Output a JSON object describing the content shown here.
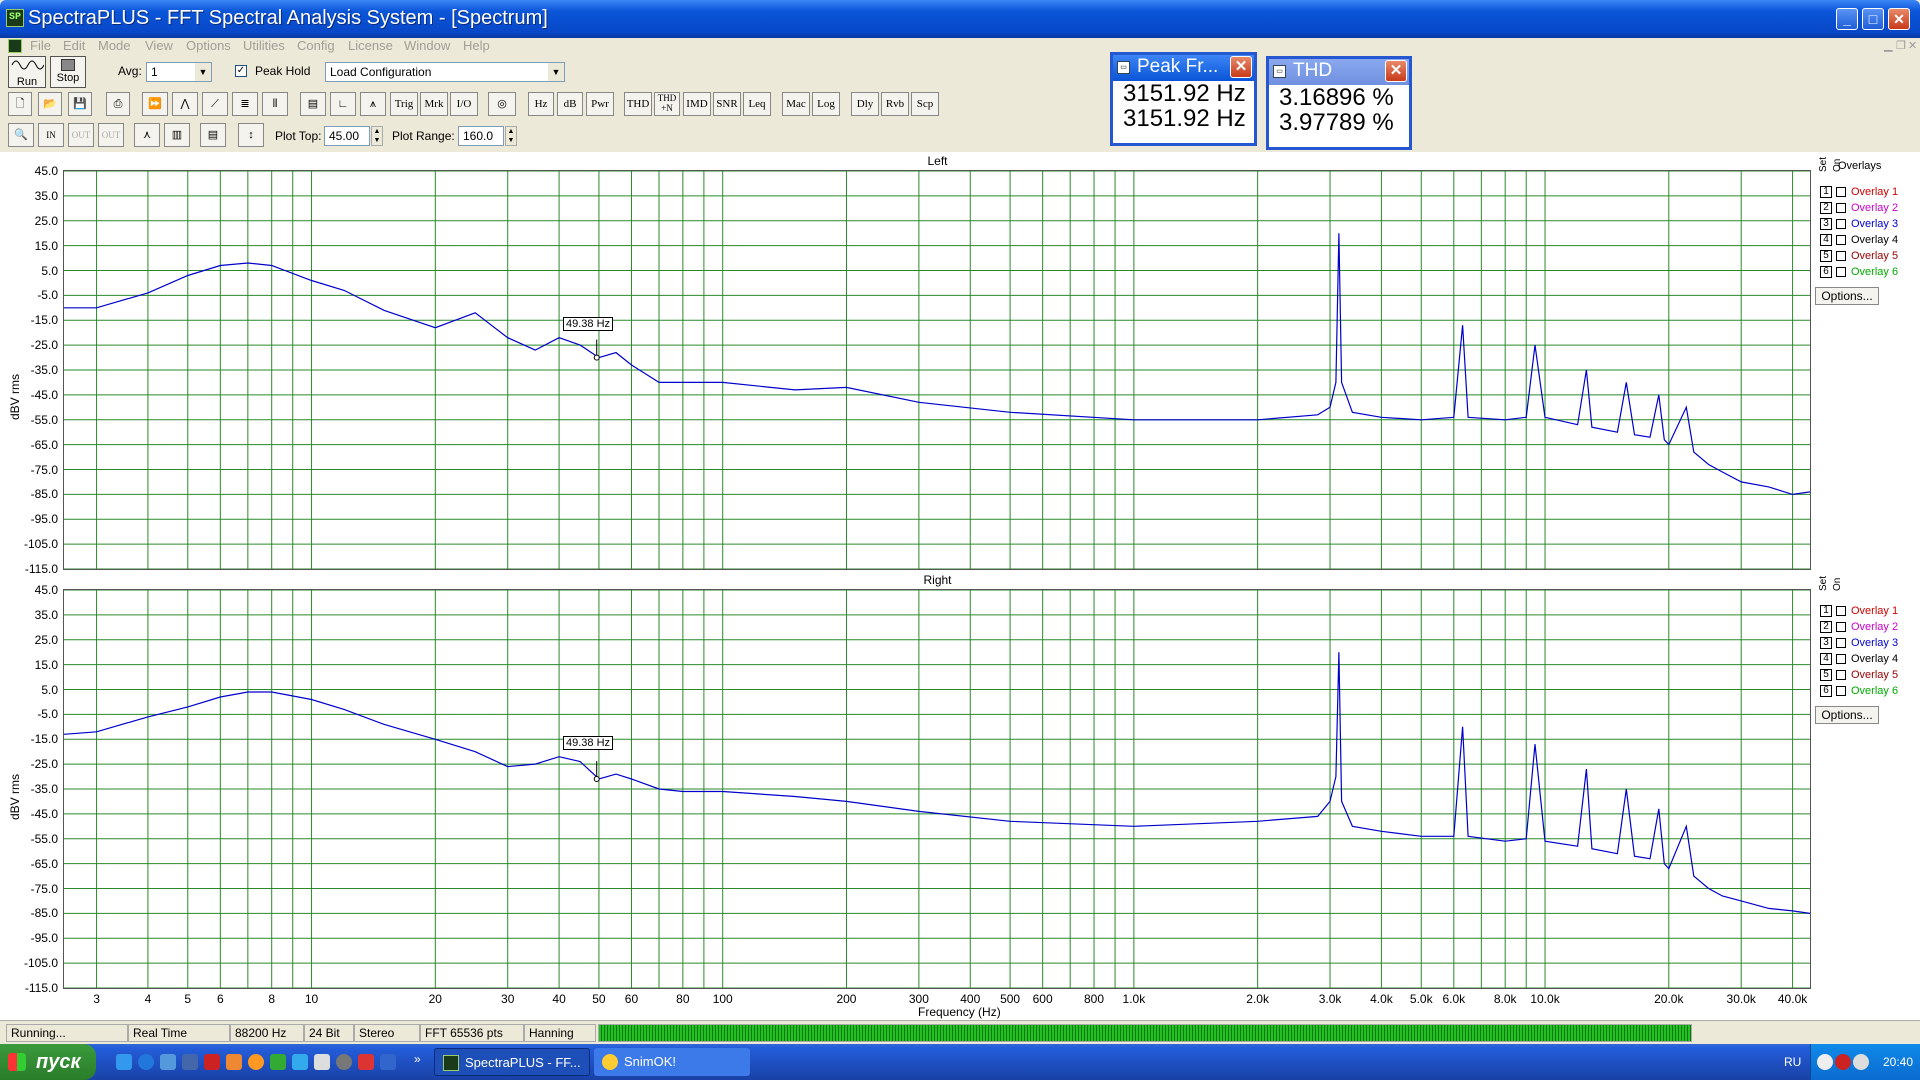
{
  "window": {
    "title": "SpectraPLUS - FFT Spectral Analysis System - [Spectrum]"
  },
  "menu": [
    "File",
    "Edit",
    "Mode",
    "View",
    "Options",
    "Utilities",
    "Config",
    "License",
    "Window",
    "Help"
  ],
  "toolbar1": {
    "run": "Run",
    "stop": "Stop",
    "avg_label": "Avg:",
    "avg_value": "1",
    "peak_hold_label": "Peak Hold",
    "peak_hold_checked": true,
    "load_config": "Load Configuration"
  },
  "toolbar2": {
    "buttons": [
      "Trig",
      "Mrk",
      "I/O",
      "Hz",
      "dB",
      "Pwr",
      "THD",
      "THD +N",
      "IMD",
      "SNR",
      "Leq",
      "Mac",
      "Log",
      "Dly",
      "Rvb",
      "Scp"
    ]
  },
  "toolbar3": {
    "plot_top_label": "Plot Top:",
    "plot_top_value": "45.00",
    "plot_range_label": "Plot Range:",
    "plot_range_value": "160.0"
  },
  "peak_window": {
    "title": "Peak Fr...",
    "values": [
      "3151.92 Hz",
      "3151.92 Hz"
    ]
  },
  "thd_window": {
    "title": "THD",
    "values": [
      "3.16896 %",
      "3.97789 %"
    ]
  },
  "panels": [
    {
      "title": "Left",
      "ylabel": "dBV rms",
      "marker": "49.38 Hz"
    },
    {
      "title": "Right",
      "ylabel": "dBV rms",
      "marker": "49.38 Hz"
    }
  ],
  "y_ticks": [
    "45.0",
    "35.0",
    "25.0",
    "15.0",
    "5.0",
    "-5.0",
    "-15.0",
    "-25.0",
    "-35.0",
    "-45.0",
    "-55.0",
    "-65.0",
    "-75.0",
    "-85.0",
    "-95.0",
    "-105.0",
    "-115.0"
  ],
  "x_ticks": [
    "3",
    "4",
    "5",
    "6",
    "8",
    "10",
    "20",
    "30",
    "40",
    "50",
    "60",
    "80",
    "100",
    "200",
    "300",
    "400",
    "500",
    "600",
    "800",
    "1.0k",
    "2.0k",
    "3.0k",
    "4.0k",
    "5.0k",
    "6.0k",
    "8.0k",
    "10.0k",
    "20.0k",
    "30.0k",
    "40.0k"
  ],
  "xlabel": "Frequency (Hz)",
  "overlays": {
    "header": "Overlays",
    "set_label": "Set",
    "on_label": "On",
    "items": [
      {
        "num": "1",
        "name": "Overlay 1",
        "color": "#cc0000"
      },
      {
        "num": "2",
        "name": "Overlay 2",
        "color": "#cc00cc"
      },
      {
        "num": "3",
        "name": "Overlay 3",
        "color": "#0000cc"
      },
      {
        "num": "4",
        "name": "Overlay 4",
        "color": "#000000"
      },
      {
        "num": "5",
        "name": "Overlay 5",
        "color": "#990000"
      },
      {
        "num": "6",
        "name": "Overlay 6",
        "color": "#00aa00"
      }
    ],
    "options": "Options..."
  },
  "chart_data": [
    {
      "type": "line",
      "title": "Left",
      "xlabel": "Frequency (Hz)",
      "ylabel": "dBV rms",
      "xscale": "log",
      "xlim": [
        2.5,
        44100
      ],
      "ylim": [
        -115,
        45
      ],
      "grid": true,
      "series_color": "#0000cc",
      "series": [
        {
          "x": [
            2.5,
            3,
            4,
            5,
            6,
            7,
            8,
            10,
            12,
            15,
            20,
            25,
            30,
            35,
            40,
            45,
            50,
            55,
            60,
            70,
            80,
            100,
            150,
            200,
            300,
            500,
            1000,
            2000,
            2800,
            3000,
            3100,
            3152,
            3200,
            3400,
            4000,
            5000,
            6000,
            6304,
            6500,
            8000,
            9000,
            9456,
            10000,
            12000,
            12608,
            13000,
            15000,
            15760,
            16500,
            18000,
            18912,
            19500,
            20000,
            22064,
            23000,
            25000,
            27000,
            30000,
            35000,
            40000,
            44100
          ],
          "y": [
            -10,
            -10,
            -4,
            3,
            7,
            8,
            7,
            1,
            -3,
            -11,
            -18,
            -12,
            -22,
            -27,
            -22,
            -25,
            -30,
            -28,
            -33,
            -40,
            -40,
            -40,
            -43,
            -42,
            -48,
            -52,
            -55,
            -55,
            -53,
            -50,
            -40,
            20,
            -40,
            -52,
            -54,
            -55,
            -54,
            -17,
            -54,
            -55,
            -54,
            -25,
            -54,
            -57,
            -35,
            -58,
            -60,
            -40,
            -61,
            -62,
            -45,
            -63,
            -65,
            -50,
            -68,
            -73,
            -76,
            -80,
            -82,
            -85,
            -84
          ]
        }
      ]
    },
    {
      "type": "line",
      "title": "Right",
      "xlabel": "Frequency (Hz)",
      "ylabel": "dBV rms",
      "xscale": "log",
      "xlim": [
        2.5,
        44100
      ],
      "ylim": [
        -115,
        45
      ],
      "grid": true,
      "series_color": "#0000cc",
      "series": [
        {
          "x": [
            2.5,
            3,
            4,
            5,
            6,
            7,
            8,
            10,
            12,
            15,
            20,
            25,
            30,
            35,
            40,
            45,
            50,
            55,
            60,
            70,
            80,
            100,
            150,
            200,
            300,
            500,
            1000,
            2000,
            2800,
            3000,
            3100,
            3152,
            3200,
            3400,
            4000,
            5000,
            6000,
            6304,
            6500,
            8000,
            9000,
            9456,
            10000,
            12000,
            12608,
            13000,
            15000,
            15760,
            16500,
            18000,
            18912,
            19500,
            20000,
            22064,
            23000,
            25000,
            27000,
            30000,
            35000,
            40000,
            44100
          ],
          "y": [
            -13,
            -12,
            -6,
            -2,
            2,
            4,
            4,
            1,
            -3,
            -9,
            -15,
            -20,
            -26,
            -25,
            -22,
            -24,
            -31,
            -29,
            -31,
            -35,
            -36,
            -36,
            -38,
            -40,
            -44,
            -48,
            -50,
            -48,
            -46,
            -40,
            -30,
            20,
            -40,
            -50,
            -52,
            -54,
            -54,
            -10,
            -54,
            -56,
            -55,
            -17,
            -56,
            -58,
            -27,
            -59,
            -61,
            -35,
            -62,
            -63,
            -43,
            -65,
            -67,
            -50,
            -70,
            -75,
            -78,
            -80,
            -83,
            -84,
            -85
          ]
        }
      ]
    }
  ],
  "status": [
    "Running...",
    "Real Time",
    "88200 Hz",
    "24 Bit",
    "Stereo",
    "FFT 65536 pts",
    "Hanning"
  ],
  "taskbar": {
    "start": "пуск",
    "tasks": [
      "SpectraPLUS - FF...",
      "SnimOK!"
    ],
    "lang": "RU",
    "clock": "20:40"
  }
}
